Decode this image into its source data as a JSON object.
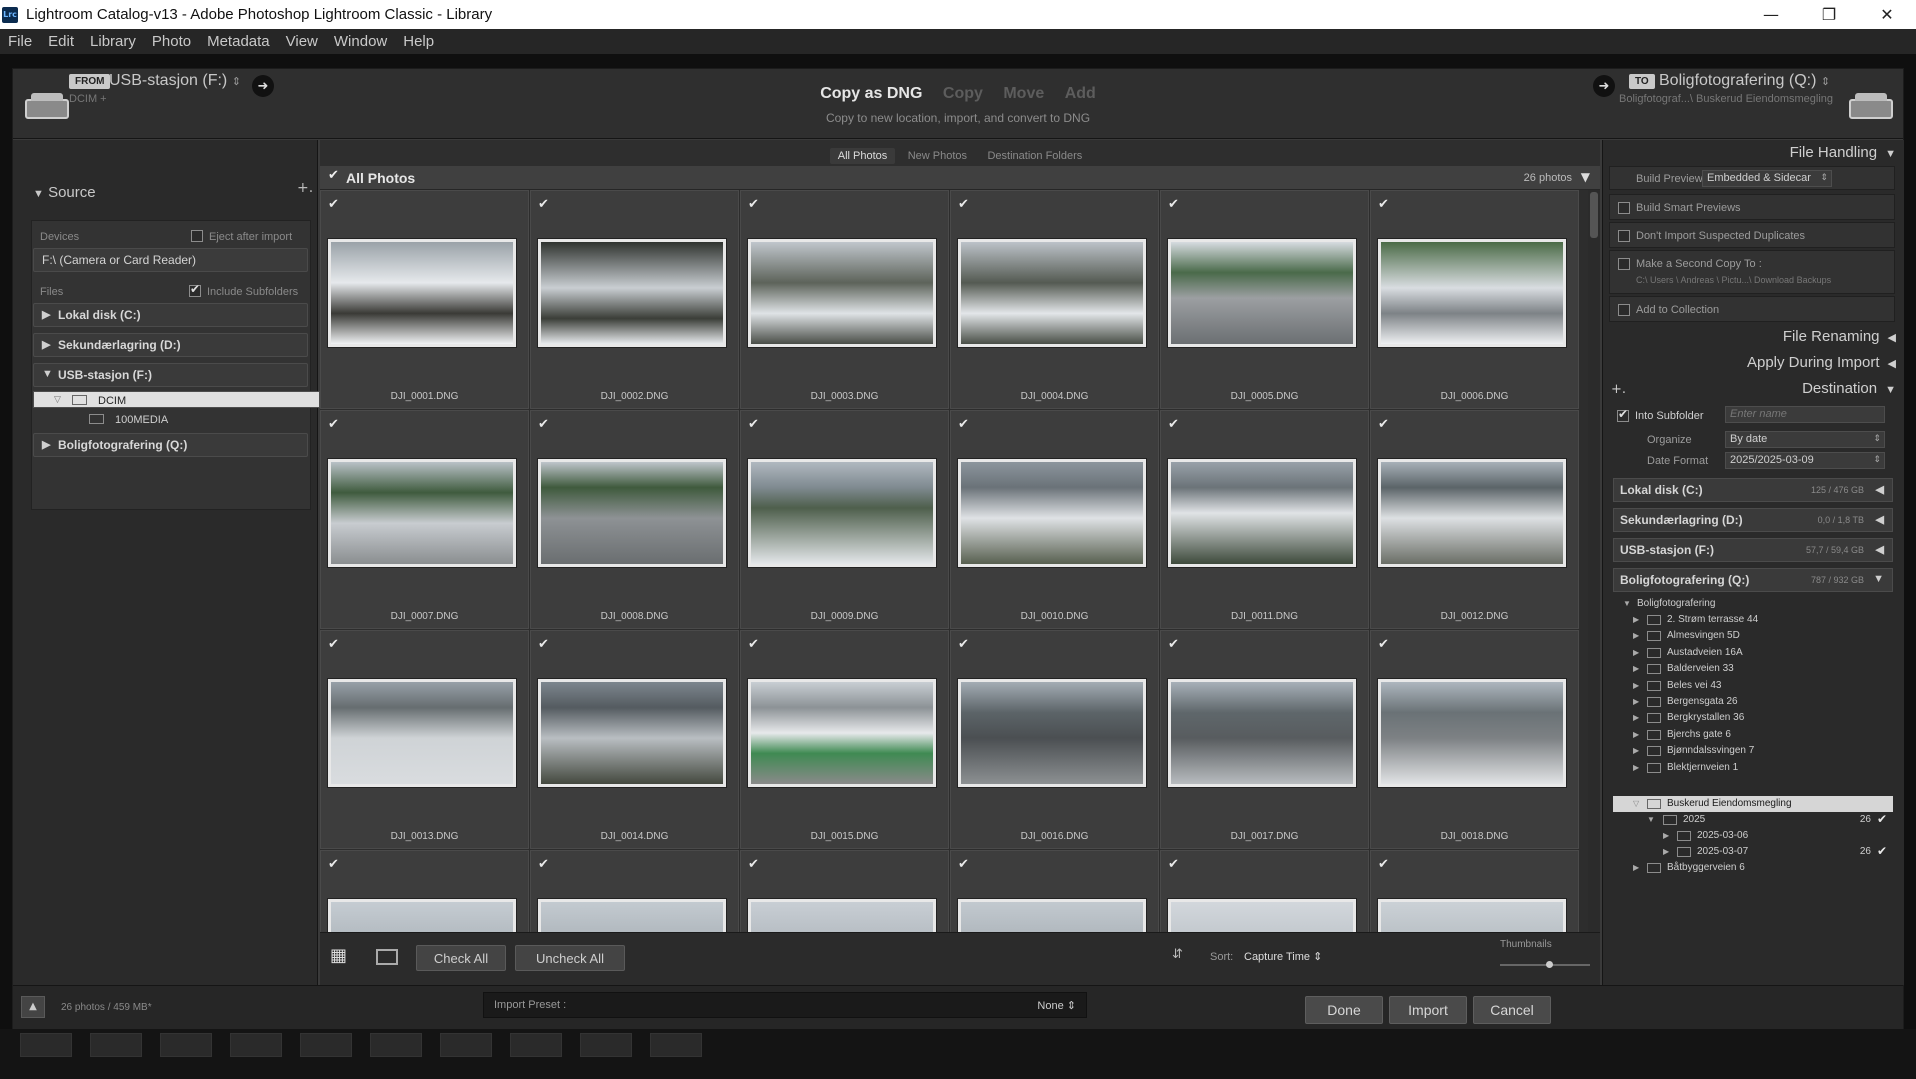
{
  "window": {
    "title": "Lightroom Catalog-v13 - Adobe Photoshop Lightroom Classic - Library",
    "app_icon": "Lrc",
    "minimize": "—",
    "restore": "❐",
    "close": "✕"
  },
  "menu": [
    "File",
    "Edit",
    "Library",
    "Photo",
    "Metadata",
    "View",
    "Window",
    "Help"
  ],
  "top": {
    "from_badge": "FROM",
    "source": "USB-stasjon (F:)",
    "source_path": "DCIM +",
    "modes": [
      "Copy as DNG",
      "Copy",
      "Move",
      "Add"
    ],
    "mode_desc": "Copy to new location, import, and convert to DNG",
    "to_badge": "TO",
    "destination": "Boligfotografering (Q:)",
    "dest_path": "Boligfotograf...\\ Buskerud Eiendomsmegling"
  },
  "source_panel": {
    "title": "Source",
    "devices_label": "Devices",
    "eject_label": "Eject after import",
    "device": "F:\\ (Camera or Card Reader)",
    "files_label": "Files",
    "include_sub": "Include Subfolders",
    "volumes": [
      {
        "name": "Lokal disk (C:)",
        "tri": "▶"
      },
      {
        "name": "Sekundærlagring (D:)",
        "tri": "▶"
      },
      {
        "name": "USB-stasjon (F:)",
        "tri": "▼"
      }
    ],
    "folder_dcim": "DCIM",
    "folder_100": "100MEDIA",
    "volume_q": "Boligfotografering (Q:)"
  },
  "center": {
    "tabs": [
      "All Photos",
      "New Photos",
      "Destination Folders"
    ],
    "grid_title": "All Photos",
    "count": "26 photos",
    "files": [
      "DJI_0001.DNG",
      "DJI_0002.DNG",
      "DJI_0003.DNG",
      "DJI_0004.DNG",
      "DJI_0005.DNG",
      "DJI_0006.DNG",
      "DJI_0007.DNG",
      "DJI_0008.DNG",
      "DJI_0009.DNG",
      "DJI_0010.DNG",
      "DJI_0011.DNG",
      "DJI_0012.DNG",
      "DJI_0013.DNG",
      "DJI_0014.DNG",
      "DJI_0015.DNG",
      "DJI_0016.DNG",
      "DJI_0017.DNG",
      "DJI_0018.DNG",
      "",
      "",
      "",
      "",
      "",
      ""
    ],
    "check_all": "Check All",
    "uncheck_all": "Uncheck All",
    "sort_label": "Sort:",
    "sort_value": "Capture Time",
    "thumbnails_label": "Thumbnails"
  },
  "right_panel": {
    "file_handling": "File Handling",
    "build_previews_label": "Build Previews",
    "build_previews_value": "Embedded & Sidecar",
    "smart_previews": "Build Smart Previews",
    "no_duplicates": "Don't Import Suspected Duplicates",
    "second_copy": "Make a Second Copy To :",
    "second_copy_path": "C:\\ Users \\ Andreas \\ Pictu...\\ Download Backups",
    "add_collection": "Add to Collection",
    "file_renaming": "File Renaming",
    "apply_during": "Apply During Import",
    "destination": "Destination",
    "into_subfolder": "Into Subfolder",
    "subfolder_placeholder": "Enter name",
    "organize_label": "Organize",
    "organize_value": "By date",
    "date_format_label": "Date Format",
    "date_format_value": "2025/2025-03-09",
    "drives": [
      {
        "name": "Lokal disk (C:)",
        "cap": "125 / 476 GB",
        "arrow": "◀"
      },
      {
        "name": "Sekundærlagring (D:)",
        "cap": "0,0 / 1,8 TB",
        "arrow": "◀"
      },
      {
        "name": "USB-stasjon (F:)",
        "cap": "57,7 / 59,4 GB",
        "arrow": "◀"
      },
      {
        "name": "Boligfotografering (Q:)",
        "cap": "787 / 932 GB",
        "arrow": "▼"
      }
    ],
    "root_folder": "Boligfotografering",
    "folders": [
      "2. Strøm terrasse 44",
      "Almesvingen 5D",
      "Austadveien 16A",
      "Balderveien 33",
      "Beles vei 43",
      "Bergensgata 26",
      "Bergkrystallen 36",
      "Bjerchs gate 6",
      "Bjønndalssvingen 7",
      "Blektjernveien 1"
    ],
    "selected_folder": "Buskerud Eiendomsmegling",
    "year": "2025",
    "year_count": "26",
    "sub1": "2025-03-06",
    "sub2": "2025-03-07",
    "sub2_count": "26",
    "next_folder": "Båtbyggerveien 6"
  },
  "bottom": {
    "status": "26 photos / 459 MB*",
    "preset_label": "Import Preset :",
    "preset_value": "None ⇕",
    "done": "Done",
    "import": "Import",
    "cancel": "Cancel"
  }
}
